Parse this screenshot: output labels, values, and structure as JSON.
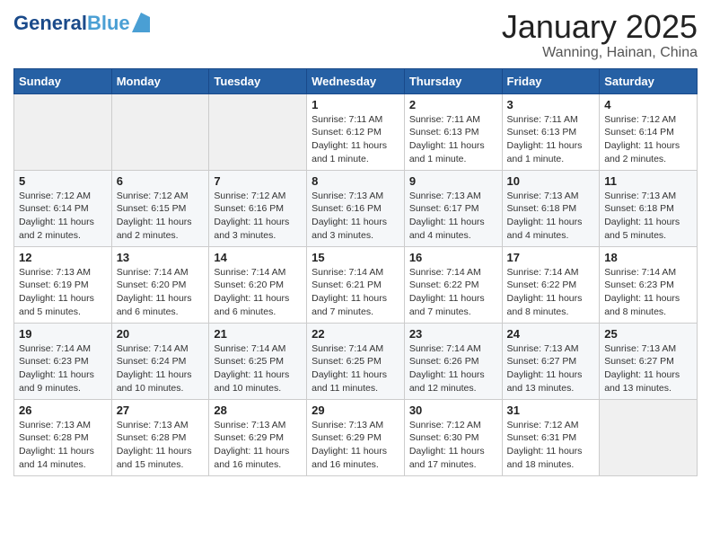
{
  "header": {
    "logo": {
      "line1": "General",
      "line2": "Blue"
    },
    "title": "January 2025",
    "location": "Wanning, Hainan, China"
  },
  "weekdays": [
    "Sunday",
    "Monday",
    "Tuesday",
    "Wednesday",
    "Thursday",
    "Friday",
    "Saturday"
  ],
  "weeks": [
    [
      {
        "day": "",
        "info": ""
      },
      {
        "day": "",
        "info": ""
      },
      {
        "day": "",
        "info": ""
      },
      {
        "day": "1",
        "info": "Sunrise: 7:11 AM\nSunset: 6:12 PM\nDaylight: 11 hours\nand 1 minute."
      },
      {
        "day": "2",
        "info": "Sunrise: 7:11 AM\nSunset: 6:13 PM\nDaylight: 11 hours\nand 1 minute."
      },
      {
        "day": "3",
        "info": "Sunrise: 7:11 AM\nSunset: 6:13 PM\nDaylight: 11 hours\nand 1 minute."
      },
      {
        "day": "4",
        "info": "Sunrise: 7:12 AM\nSunset: 6:14 PM\nDaylight: 11 hours\nand 2 minutes."
      }
    ],
    [
      {
        "day": "5",
        "info": "Sunrise: 7:12 AM\nSunset: 6:14 PM\nDaylight: 11 hours\nand 2 minutes."
      },
      {
        "day": "6",
        "info": "Sunrise: 7:12 AM\nSunset: 6:15 PM\nDaylight: 11 hours\nand 2 minutes."
      },
      {
        "day": "7",
        "info": "Sunrise: 7:12 AM\nSunset: 6:16 PM\nDaylight: 11 hours\nand 3 minutes."
      },
      {
        "day": "8",
        "info": "Sunrise: 7:13 AM\nSunset: 6:16 PM\nDaylight: 11 hours\nand 3 minutes."
      },
      {
        "day": "9",
        "info": "Sunrise: 7:13 AM\nSunset: 6:17 PM\nDaylight: 11 hours\nand 4 minutes."
      },
      {
        "day": "10",
        "info": "Sunrise: 7:13 AM\nSunset: 6:18 PM\nDaylight: 11 hours\nand 4 minutes."
      },
      {
        "day": "11",
        "info": "Sunrise: 7:13 AM\nSunset: 6:18 PM\nDaylight: 11 hours\nand 5 minutes."
      }
    ],
    [
      {
        "day": "12",
        "info": "Sunrise: 7:13 AM\nSunset: 6:19 PM\nDaylight: 11 hours\nand 5 minutes."
      },
      {
        "day": "13",
        "info": "Sunrise: 7:14 AM\nSunset: 6:20 PM\nDaylight: 11 hours\nand 6 minutes."
      },
      {
        "day": "14",
        "info": "Sunrise: 7:14 AM\nSunset: 6:20 PM\nDaylight: 11 hours\nand 6 minutes."
      },
      {
        "day": "15",
        "info": "Sunrise: 7:14 AM\nSunset: 6:21 PM\nDaylight: 11 hours\nand 7 minutes."
      },
      {
        "day": "16",
        "info": "Sunrise: 7:14 AM\nSunset: 6:22 PM\nDaylight: 11 hours\nand 7 minutes."
      },
      {
        "day": "17",
        "info": "Sunrise: 7:14 AM\nSunset: 6:22 PM\nDaylight: 11 hours\nand 8 minutes."
      },
      {
        "day": "18",
        "info": "Sunrise: 7:14 AM\nSunset: 6:23 PM\nDaylight: 11 hours\nand 8 minutes."
      }
    ],
    [
      {
        "day": "19",
        "info": "Sunrise: 7:14 AM\nSunset: 6:23 PM\nDaylight: 11 hours\nand 9 minutes."
      },
      {
        "day": "20",
        "info": "Sunrise: 7:14 AM\nSunset: 6:24 PM\nDaylight: 11 hours\nand 10 minutes."
      },
      {
        "day": "21",
        "info": "Sunrise: 7:14 AM\nSunset: 6:25 PM\nDaylight: 11 hours\nand 10 minutes."
      },
      {
        "day": "22",
        "info": "Sunrise: 7:14 AM\nSunset: 6:25 PM\nDaylight: 11 hours\nand 11 minutes."
      },
      {
        "day": "23",
        "info": "Sunrise: 7:14 AM\nSunset: 6:26 PM\nDaylight: 11 hours\nand 12 minutes."
      },
      {
        "day": "24",
        "info": "Sunrise: 7:13 AM\nSunset: 6:27 PM\nDaylight: 11 hours\nand 13 minutes."
      },
      {
        "day": "25",
        "info": "Sunrise: 7:13 AM\nSunset: 6:27 PM\nDaylight: 11 hours\nand 13 minutes."
      }
    ],
    [
      {
        "day": "26",
        "info": "Sunrise: 7:13 AM\nSunset: 6:28 PM\nDaylight: 11 hours\nand 14 minutes."
      },
      {
        "day": "27",
        "info": "Sunrise: 7:13 AM\nSunset: 6:28 PM\nDaylight: 11 hours\nand 15 minutes."
      },
      {
        "day": "28",
        "info": "Sunrise: 7:13 AM\nSunset: 6:29 PM\nDaylight: 11 hours\nand 16 minutes."
      },
      {
        "day": "29",
        "info": "Sunrise: 7:13 AM\nSunset: 6:29 PM\nDaylight: 11 hours\nand 16 minutes."
      },
      {
        "day": "30",
        "info": "Sunrise: 7:12 AM\nSunset: 6:30 PM\nDaylight: 11 hours\nand 17 minutes."
      },
      {
        "day": "31",
        "info": "Sunrise: 7:12 AM\nSunset: 6:31 PM\nDaylight: 11 hours\nand 18 minutes."
      },
      {
        "day": "",
        "info": ""
      }
    ]
  ]
}
